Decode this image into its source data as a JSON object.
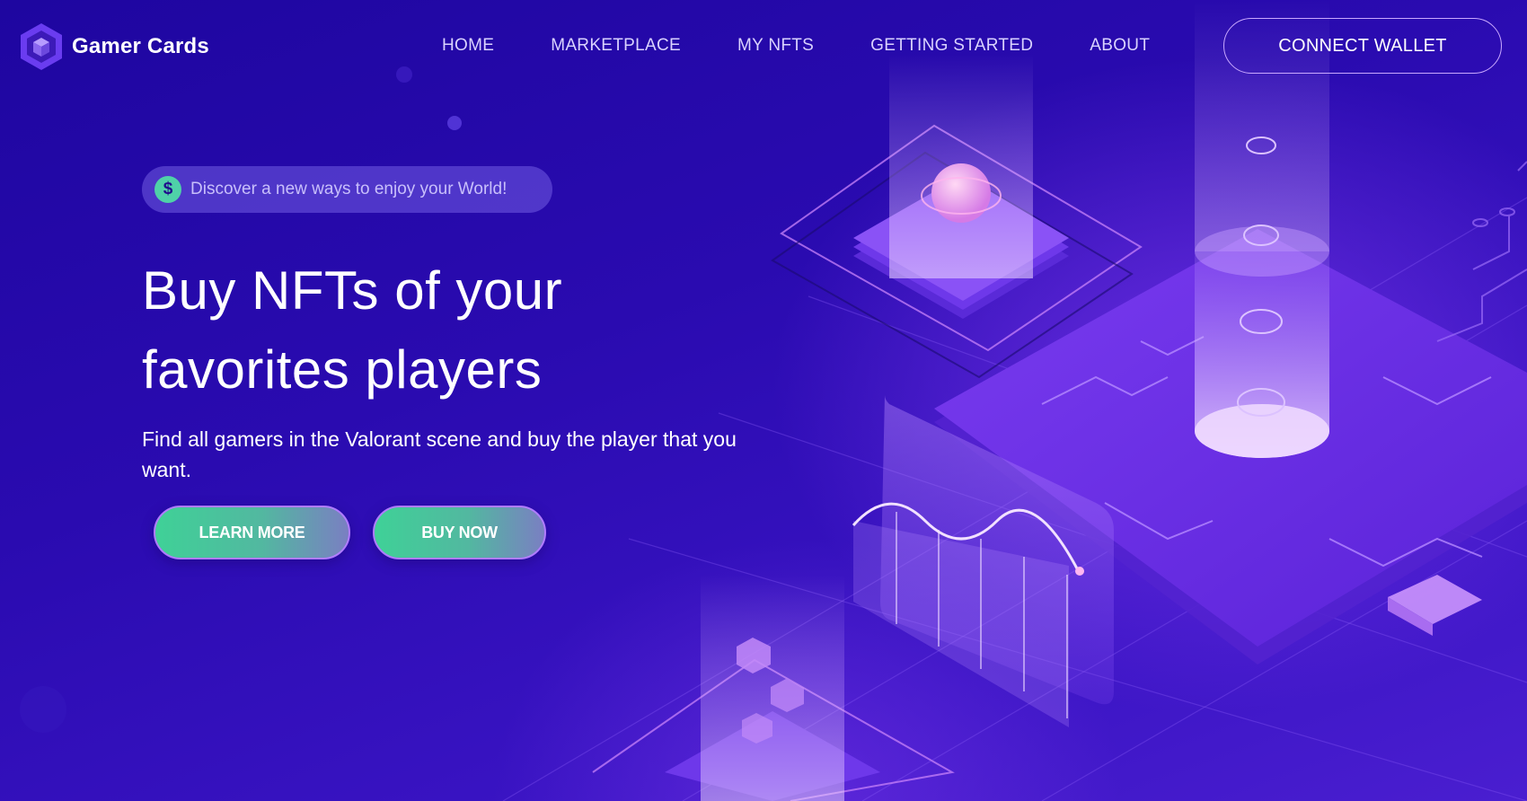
{
  "brand": {
    "name": "Gamer Cards",
    "logo_icon": "hexagon-cube-icon"
  },
  "nav": {
    "items": [
      "HOME",
      "MARKETPLACE",
      "MY NFTS",
      "GETTING STARTED",
      "ABOUT"
    ],
    "connect_label": "CONNECT WALLET"
  },
  "hero": {
    "badge_icon": "dollar-coin-icon",
    "badge_text": "Discover a new ways to enjoy your World!",
    "title_line1": "Buy NFTs of your",
    "title_line2": "favorites players",
    "subtitle": "Find all gamers in the Valorant scene and buy the player that you want.",
    "learn_more_label": "LEARN MORE",
    "buy_now_label": "BUY NOW"
  },
  "colors": {
    "background": "#2a0aa8",
    "accent_green": "#3fd197",
    "accent_purple": "#b07cff",
    "nav_text": "#d9d2ff"
  }
}
